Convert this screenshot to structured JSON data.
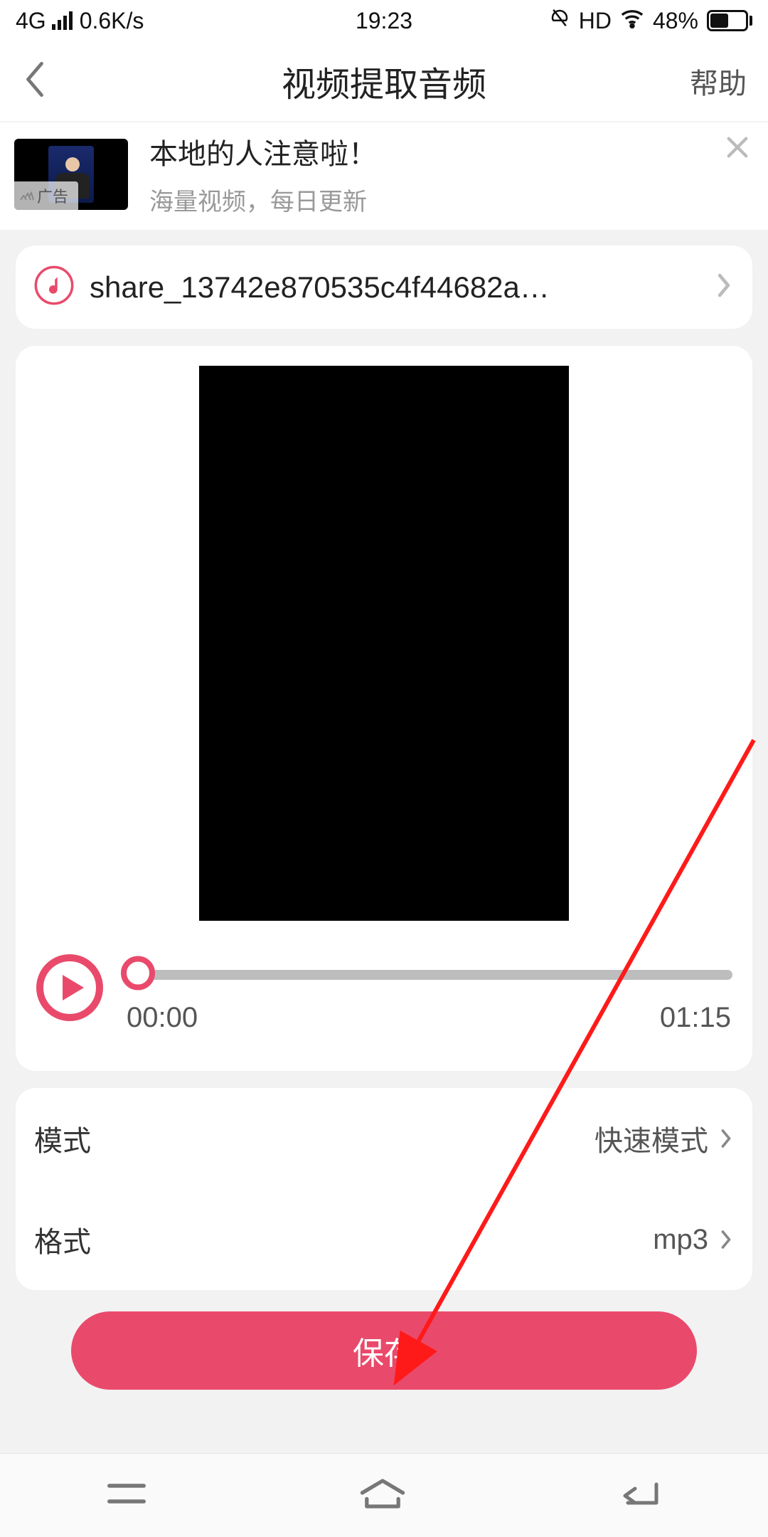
{
  "status": {
    "network": "4G",
    "speed": "0.6K/s",
    "time": "19:23",
    "hd": "HD",
    "battery_pct": "48%"
  },
  "header": {
    "title": "视频提取音频",
    "help": "帮助"
  },
  "ad": {
    "badge": "广告",
    "title": "本地的人注意啦！",
    "subtitle": "海量视频，每日更新"
  },
  "file": {
    "name": "share_13742e870535c4f44682a…"
  },
  "player": {
    "current": "00:00",
    "duration": "01:15"
  },
  "settings": {
    "mode_label": "模式",
    "mode_value": "快速模式",
    "format_label": "格式",
    "format_value": "mp3"
  },
  "actions": {
    "save": "保存"
  },
  "colors": {
    "accent": "#e94a6b"
  }
}
